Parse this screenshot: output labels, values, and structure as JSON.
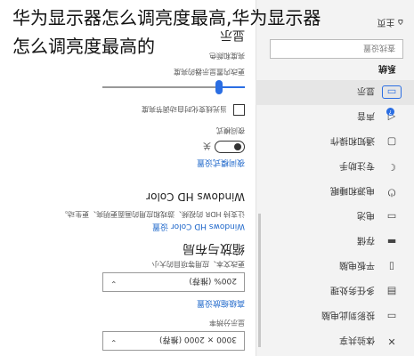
{
  "overlay": {
    "line1": "华为显示器怎么调亮度最高,华为显示器",
    "line2": "怎么调亮度最高的"
  },
  "content": {
    "page_title": "显示",
    "brightness_heading": "亮度和颜色",
    "brightness_label": "更改内置显示器的亮度",
    "brightness_value": 0.18,
    "auto_brightness_label": "当光线变化时自动调节亮度",
    "night_light_label": "夜间模式",
    "night_light_state": "关",
    "night_light_link": "夜间模式设置",
    "hdr_heading": "Windows HD Color",
    "hdr_desc_1": "让支持 HDR 的视频、游戏和应用的画面更明亮、更生动。",
    "hdr_link": "Windows HD Color 设置",
    "scale_heading": "缩放与布局",
    "scale_label": "更改文本、应用等项目的大小",
    "scale_value": "200% (推荐)",
    "advanced_scale_link": "高级缩放设置",
    "resolution_label": "显示分辨率",
    "resolution_value": "3000 × 2000 (推荐)"
  },
  "sidebar": {
    "title": "系统",
    "find_placeholder": "查找设置",
    "home_label": "主页",
    "badge": "?",
    "items": [
      {
        "label": "显示",
        "icon": "monitor-icon"
      },
      {
        "label": "声音",
        "icon": "speaker-icon"
      },
      {
        "label": "通知和操作",
        "icon": "notification-icon"
      },
      {
        "label": "专注助手",
        "icon": "moon-icon"
      },
      {
        "label": "电源和睡眠",
        "icon": "power-icon"
      },
      {
        "label": "电池",
        "icon": "battery-icon"
      },
      {
        "label": "存储",
        "icon": "storage-icon"
      },
      {
        "label": "平板电脑",
        "icon": "tablet-icon"
      },
      {
        "label": "多任务处理",
        "icon": "multitask-icon"
      },
      {
        "label": "投影到此电脑",
        "icon": "project-icon"
      },
      {
        "label": "体验共享",
        "icon": "share-icon"
      }
    ]
  },
  "colors": {
    "accent": "#2b6ee3",
    "link": "#1a64c9",
    "sidebar_bg": "#f3f3f3"
  }
}
